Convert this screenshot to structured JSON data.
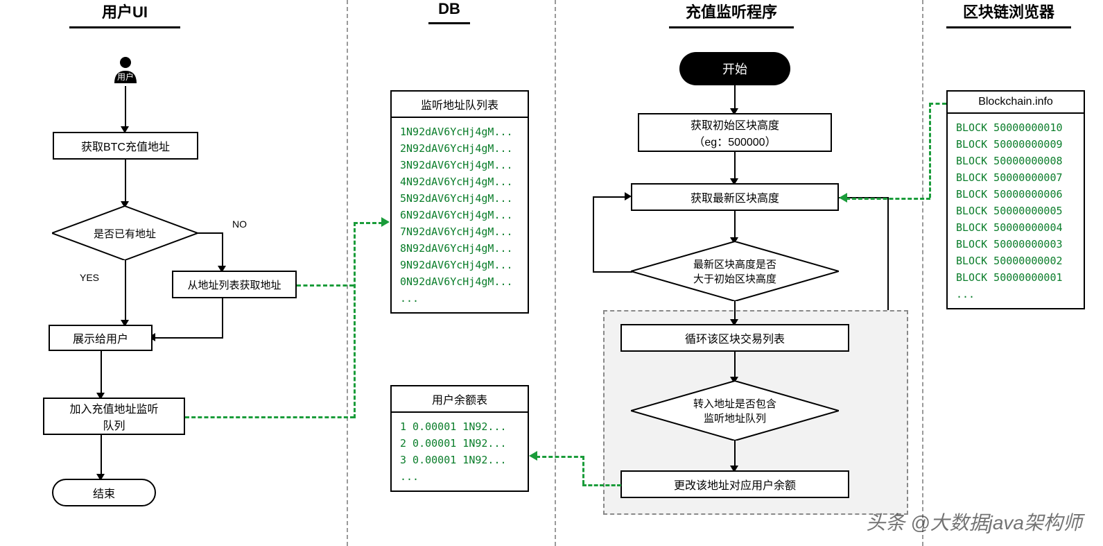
{
  "lanes": {
    "ui": "用户UI",
    "db": "DB",
    "listener": "充值监听程序",
    "explorer": "区块链浏览器"
  },
  "ui": {
    "actor": "用户",
    "get_addr": "获取BTC充值地址",
    "has_addr": "是否已有地址",
    "yes": "YES",
    "no": "NO",
    "from_list": "从地址列表获取地址",
    "show_user": "展示给用户",
    "add_queue": "加入充值地址监听\n队列",
    "end": "结束"
  },
  "db": {
    "addr_queue_title": "监听地址队列表",
    "addresses": [
      "1N92dAV6YcHj4gM...",
      "2N92dAV6YcHj4gM...",
      "3N92dAV6YcHj4gM...",
      "4N92dAV6YcHj4gM...",
      "5N92dAV6YcHj4gM...",
      "6N92dAV6YcHj4gM...",
      "7N92dAV6YcHj4gM...",
      "8N92dAV6YcHj4gM...",
      "9N92dAV6YcHj4gM...",
      "0N92dAV6YcHj4gM...",
      "..."
    ],
    "balance_title": "用户余额表",
    "balances": [
      "1  0.00001 1N92...",
      "2  0.00001 1N92...",
      "3  0.00001 1N92...",
      "..."
    ]
  },
  "listener": {
    "start": "开始",
    "get_init": "获取初始区块高度\n（eg：500000）",
    "get_latest": "获取最新区块高度",
    "cmp": "最新区块高度是否\n大于初始区块高度",
    "loop_tx": "循环该区块交易列表",
    "match_addr": "转入地址是否包含\n监听地址队列",
    "update_bal": "更改该地址对应用户余额"
  },
  "explorer": {
    "title": "Blockchain.info",
    "blocks": [
      "BLOCK 50000000010",
      "BLOCK 50000000009",
      "BLOCK 50000000008",
      "BLOCK 50000000007",
      "BLOCK 50000000006",
      "BLOCK 50000000005",
      "BLOCK 50000000004",
      "BLOCK 50000000003",
      "BLOCK 50000000002",
      "BLOCK 50000000001",
      "..."
    ]
  },
  "watermark": "头条 @大数据java架构师"
}
